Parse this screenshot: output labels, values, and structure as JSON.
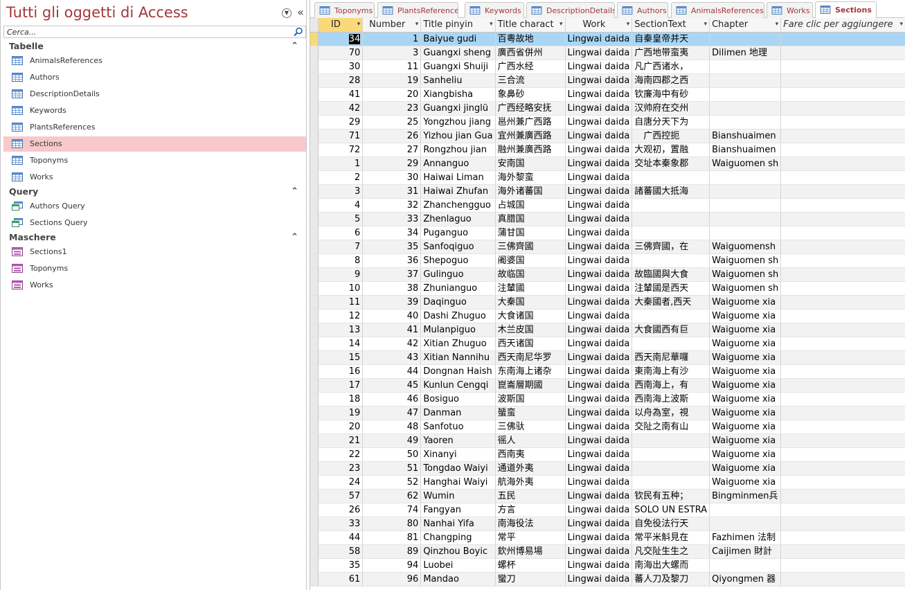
{
  "nav": {
    "title": "Tutti gli oggetti di Access",
    "search_placeholder": "Cerca...",
    "groups": [
      {
        "label": "Tabelle",
        "items": [
          "AnimalsReferences",
          "Authors",
          "DescriptionDetails",
          "Keywords",
          "PlantsReferences",
          "Sections",
          "Toponyms",
          "Works"
        ]
      },
      {
        "label": "Query",
        "items": [
          "Authors Query",
          "Sections Query"
        ]
      },
      {
        "label": "Maschere",
        "items": [
          "Sections1",
          "Toponyms",
          "Works"
        ]
      }
    ],
    "selected_item": "Sections"
  },
  "tabs": [
    "Toponyms",
    "PlantsReferences",
    "Keywords",
    "DescriptionDetails",
    "Authors",
    "AnimalsReferences",
    "Works",
    "Sections"
  ],
  "active_tab": "Sections",
  "grid": {
    "columns": [
      "ID",
      "Number",
      "Title pinyin",
      "Title charact",
      "Work",
      "SectionText",
      "Chapter",
      "Fare clic per aggiungere"
    ],
    "rows": [
      [
        "34",
        "1",
        "Baiyue gudi",
        "百粵故地",
        "Lingwai daida",
        "自秦皇帝并天",
        ""
      ],
      [
        "70",
        "3",
        "Guangxi sheng",
        "廣西省併州",
        "Lingwai daida",
        "广西地带蛮夷",
        "Dilimen 地理"
      ],
      [
        "30",
        "11",
        "Guangxi Shuiji",
        "广西水经",
        "Lingwai daida",
        "凡广西诸水，",
        ""
      ],
      [
        "28",
        "19",
        "Sanheliu",
        "三合流",
        "Lingwai daida",
        "海南四郡之西",
        ""
      ],
      [
        "41",
        "20",
        "Xiangbisha",
        "象鼻砂",
        "Lingwai daida",
        "钦廉海中有砂",
        ""
      ],
      [
        "42",
        "23",
        "Guangxi jinglü",
        "广西经略安抚",
        "Lingwai daida",
        "汉帅府在交州",
        ""
      ],
      [
        "29",
        "25",
        "Yongzhou jiang",
        "邕州兼广西路",
        "Lingwai daida",
        "自唐分天下为",
        ""
      ],
      [
        "71",
        "26",
        "Yizhou jian Gua",
        "宜州兼廣西路",
        "Lingwai daida",
        "　广西控扼",
        "Bianshuaimen"
      ],
      [
        "72",
        "27",
        "Rongzhou jian",
        "融州兼廣西路",
        "Lingwai daida",
        "大观初，置融",
        "Bianshuaimen"
      ],
      [
        "1",
        "29",
        "Annanguo",
        "安南国",
        "Lingwai daida",
        "交址本秦象郡",
        "Waiguomen sh"
      ],
      [
        "2",
        "30",
        "Haiwai Liman",
        "海外黎蛮",
        "Lingwai daida",
        "",
        ""
      ],
      [
        "3",
        "31",
        "Haiwai Zhufan",
        "海外诸蕃国",
        "Lingwai daida",
        "諸蕃國大抵海",
        ""
      ],
      [
        "4",
        "32",
        "Zhanchengguo",
        "占城国",
        "Lingwai daida",
        "",
        ""
      ],
      [
        "5",
        "33",
        "Zhenlaguo",
        "真腊国",
        "Lingwai daida",
        "",
        ""
      ],
      [
        "6",
        "34",
        "Puganguo",
        "蒲甘国",
        "Lingwai daida",
        "",
        ""
      ],
      [
        "7",
        "35",
        "Sanfoqiguo",
        "三佛齊國",
        "Lingwai daida",
        "三佛齊國，在",
        "Waiguomensh"
      ],
      [
        "8",
        "36",
        "Shepoguo",
        "阇婆国",
        "Lingwai daida",
        "",
        "Waiguomen sh"
      ],
      [
        "9",
        "37",
        "Gulinguo",
        "故临国",
        "Lingwai daida",
        "故臨國與大食",
        "Waiguomen sh"
      ],
      [
        "10",
        "38",
        "Zhunianguo",
        "注輦國",
        "Lingwai daida",
        "注輦國是西天",
        "Waiguomen sh"
      ],
      [
        "11",
        "39",
        "Daqinguo",
        "大秦国",
        "Lingwai daida",
        "大秦國者,西天",
        "Waiguome xia"
      ],
      [
        "12",
        "40",
        "Dashi Zhuguo",
        "大食诸国",
        "Lingwai daida",
        "",
        "Waiguome xia"
      ],
      [
        "13",
        "41",
        "Mulanpiguo",
        "木兰皮国",
        "Lingwai daida",
        "大食國西有巨",
        "Waiguome xia"
      ],
      [
        "14",
        "42",
        "Xitian Zhuguo",
        "西天诸国",
        "Lingwai daida",
        "",
        "Waiguome xia"
      ],
      [
        "15",
        "43",
        "Xitian Nannihu",
        "西天南尼华罗",
        "Lingwai daida",
        "西天南尼華囉",
        "Waiguome xia"
      ],
      [
        "16",
        "44",
        "Dongnan Haish",
        "东南海上诸杂",
        "Lingwai daida",
        "東南海上有沙",
        "Waiguome xia"
      ],
      [
        "17",
        "45",
        "Kunlun Cengqi",
        "崑崙層期國",
        "Lingwai daida",
        "西南海上，有",
        "Waiguome xia"
      ],
      [
        "18",
        "46",
        "Bosiguo",
        "波斯国",
        "Lingwai daida",
        "西南海上波斯",
        "Waiguome xia"
      ],
      [
        "19",
        "47",
        "Danman",
        "蜑蛮",
        "Lingwai daida",
        "以舟為室，視",
        "Waiguome xia"
      ],
      [
        "20",
        "48",
        "Sanfotuo",
        "三佛驮",
        "Lingwai daida",
        "交阯之南有山",
        "Waiguome xia"
      ],
      [
        "21",
        "49",
        "Yaoren",
        "徭人",
        "Lingwai daida",
        "",
        "Waiguome xia"
      ],
      [
        "22",
        "50",
        "Xinanyi",
        "西南夷",
        "Lingwai daida",
        "",
        "Waiguome xia"
      ],
      [
        "23",
        "51",
        "Tongdao Waiyi",
        "通道外夷",
        "Lingwai daida",
        "",
        "Waiguome xia"
      ],
      [
        "24",
        "52",
        "Hanghai Waiyi",
        "航海外夷",
        "Lingwai daida",
        "",
        "Waiguome xia"
      ],
      [
        "57",
        "62",
        "Wumin",
        "五民",
        "Lingwai daida",
        "钦民有五种；",
        "Bingminmen兵"
      ],
      [
        "26",
        "74",
        "Fangyan",
        "方言",
        "Lingwai daida",
        "SOLO UN ESTRA",
        ""
      ],
      [
        "33",
        "80",
        "Nanhai Yifa",
        "南海役法",
        "Lingwai daida",
        "自免役法行天",
        ""
      ],
      [
        "44",
        "81",
        "Changping",
        "常平",
        "Lingwai daida",
        "常平米斛見在",
        "Fazhimen 法制"
      ],
      [
        "58",
        "89",
        "Qinzhou Boyic",
        "欽州博易場",
        "Lingwai daida",
        "凡交阯生生之",
        "Caijimen 財計"
      ],
      [
        "35",
        "94",
        "Luobei",
        "螺杯",
        "Lingwai daida",
        "南海出大螺而",
        ""
      ],
      [
        "61",
        "96",
        "Mandao",
        "蠻刀",
        "Lingwai daida",
        "蕃人刀及黎刀",
        "Qiyongmen 器"
      ]
    ]
  }
}
